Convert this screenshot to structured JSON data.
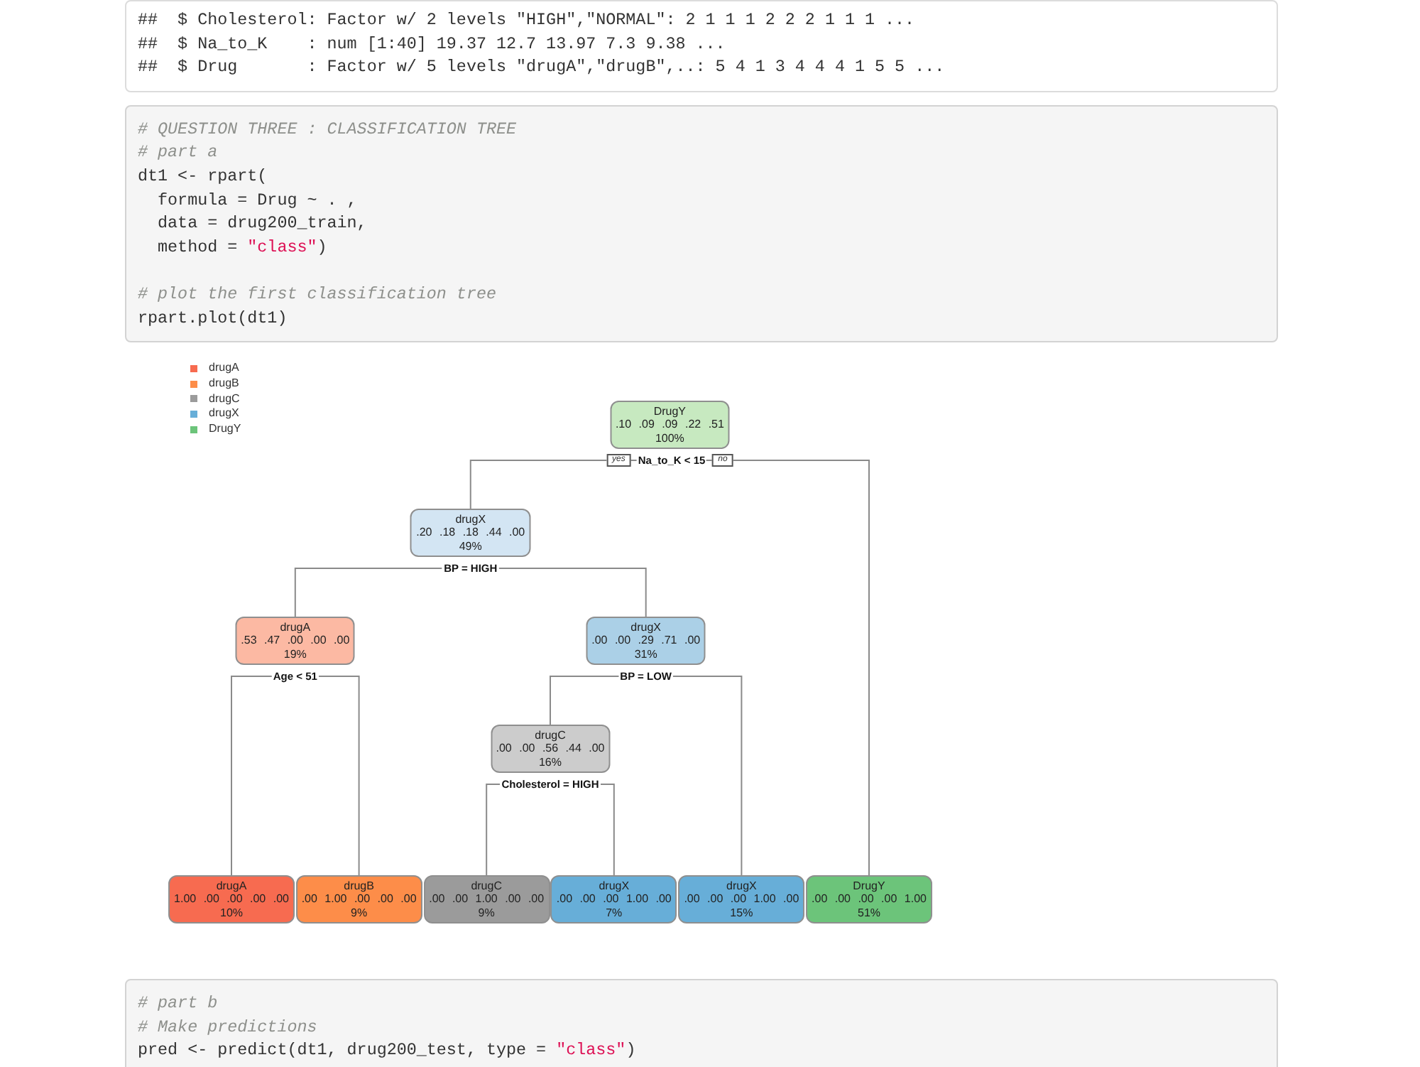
{
  "cells": [
    {
      "kind": "output",
      "lines": [
        {
          "kind": "text",
          "tokens": [
            {
              "kind": "plain",
              "text": "##  $ Cholesterol: Factor w/ 2 levels \"HIGH\",\"NORMAL\": 2 1 1 1 2 2 2 1 1 1 ..."
            }
          ]
        },
        {
          "kind": "text",
          "tokens": [
            {
              "kind": "plain",
              "text": "##  $ Na_to_K    : num [1:40] 19.37 12.7 13.97 7.3 9.38 ..."
            }
          ]
        },
        {
          "kind": "text",
          "tokens": [
            {
              "kind": "plain",
              "text": "##  $ Drug       : Factor w/ 5 levels \"drugA\",\"drugB\",..: 5 4 1 3 4 4 4 1 5 5 ..."
            }
          ]
        }
      ]
    },
    {
      "kind": "code",
      "lines": [
        {
          "kind": "text",
          "tokens": [
            {
              "kind": "comment",
              "text": "# QUESTION THREE : CLASSIFICATION TREE"
            }
          ]
        },
        {
          "kind": "text",
          "tokens": [
            {
              "kind": "comment",
              "text": "# part a"
            }
          ]
        },
        {
          "kind": "text",
          "tokens": [
            {
              "kind": "plain",
              "text": "dt1 <- rpart("
            }
          ]
        },
        {
          "kind": "text",
          "tokens": [
            {
              "kind": "plain",
              "text": "  formula = Drug ~ . ,"
            }
          ]
        },
        {
          "kind": "text",
          "tokens": [
            {
              "kind": "plain",
              "text": "  data = drug200_train,"
            }
          ]
        },
        {
          "kind": "text",
          "tokens": [
            {
              "kind": "plain",
              "text": "  method = "
            },
            {
              "kind": "string",
              "text": "\"class\""
            },
            {
              "kind": "plain",
              "text": ")"
            }
          ]
        },
        {
          "kind": "blank"
        },
        {
          "kind": "text",
          "tokens": [
            {
              "kind": "comment",
              "text": "# plot the first classification tree"
            }
          ]
        },
        {
          "kind": "text",
          "tokens": [
            {
              "kind": "plain",
              "text": "rpart.plot(dt1)"
            }
          ]
        }
      ]
    },
    {
      "kind": "tree_plot",
      "legend": [
        {
          "label": "drugA",
          "color": "#f76b50"
        },
        {
          "label": "drugB",
          "color": "#fd8d49"
        },
        {
          "label": "drugC",
          "color": "#9b9b9b"
        },
        {
          "label": "drugX",
          "color": "#67aed8"
        },
        {
          "label": "DrugY",
          "color": "#6cc47a"
        }
      ],
      "root": {
        "label": "DrugY",
        "probabilities": ".10 .09 .09 .22 .51",
        "percent": "100%",
        "color": "#c7e9c0",
        "split": "Na_to_K < 15",
        "branch_labels": {
          "yes": "yes",
          "no": "no"
        },
        "children": [
          {
            "label": "drugX",
            "probabilities": ".20 .18 .18 .44 .00",
            "percent": "49%",
            "color": "#d3e5f3",
            "split": "BP = HIGH",
            "children": [
              {
                "label": "drugA",
                "probabilities": ".53 .47 .00 .00 .00",
                "percent": "19%",
                "color": "#fcb9a3",
                "split": "Age < 51",
                "children": [
                  {
                    "label": "drugA",
                    "probabilities": "1.00 .00 .00 .00 .00",
                    "percent": "10%",
                    "color": "#f76b50"
                  },
                  {
                    "label": "drugB",
                    "probabilities": ".00 1.00 .00 .00 .00",
                    "percent": "9%",
                    "color": "#fd8d49"
                  }
                ]
              },
              {
                "label": "drugX",
                "probabilities": ".00 .00 .29 .71 .00",
                "percent": "31%",
                "color": "#abd0e7",
                "split": "BP = LOW",
                "children": [
                  {
                    "label": "drugC",
                    "probabilities": ".00 .00 .56 .44 .00",
                    "percent": "16%",
                    "color": "#cccccc",
                    "split": "Cholesterol = HIGH",
                    "children": [
                      {
                        "label": "drugC",
                        "probabilities": ".00 .00 1.00 .00 .00",
                        "percent": "9%",
                        "color": "#9b9b9b"
                      },
                      {
                        "label": "drugX",
                        "probabilities": ".00 .00 .00 1.00 .00",
                        "percent": "7%",
                        "color": "#67aed8"
                      }
                    ]
                  },
                  {
                    "label": "drugX",
                    "probabilities": ".00 .00 .00 1.00 .00",
                    "percent": "15%",
                    "color": "#67aed8"
                  }
                ]
              }
            ]
          },
          {
            "label": "DrugY",
            "probabilities": ".00 .00 .00 .00 1.00",
            "percent": "51%",
            "color": "#6cc47a"
          }
        ]
      }
    },
    {
      "kind": "code",
      "lines": [
        {
          "kind": "text",
          "tokens": [
            {
              "kind": "comment",
              "text": "# part b"
            }
          ]
        },
        {
          "kind": "text",
          "tokens": [
            {
              "kind": "comment",
              "text": "# Make predictions"
            }
          ]
        },
        {
          "kind": "text",
          "tokens": [
            {
              "kind": "plain",
              "text": "pred <- predict(dt1, drug200_test, type = "
            },
            {
              "kind": "string",
              "text": "\"class\""
            },
            {
              "kind": "plain",
              "text": ")"
            }
          ]
        }
      ]
    }
  ]
}
